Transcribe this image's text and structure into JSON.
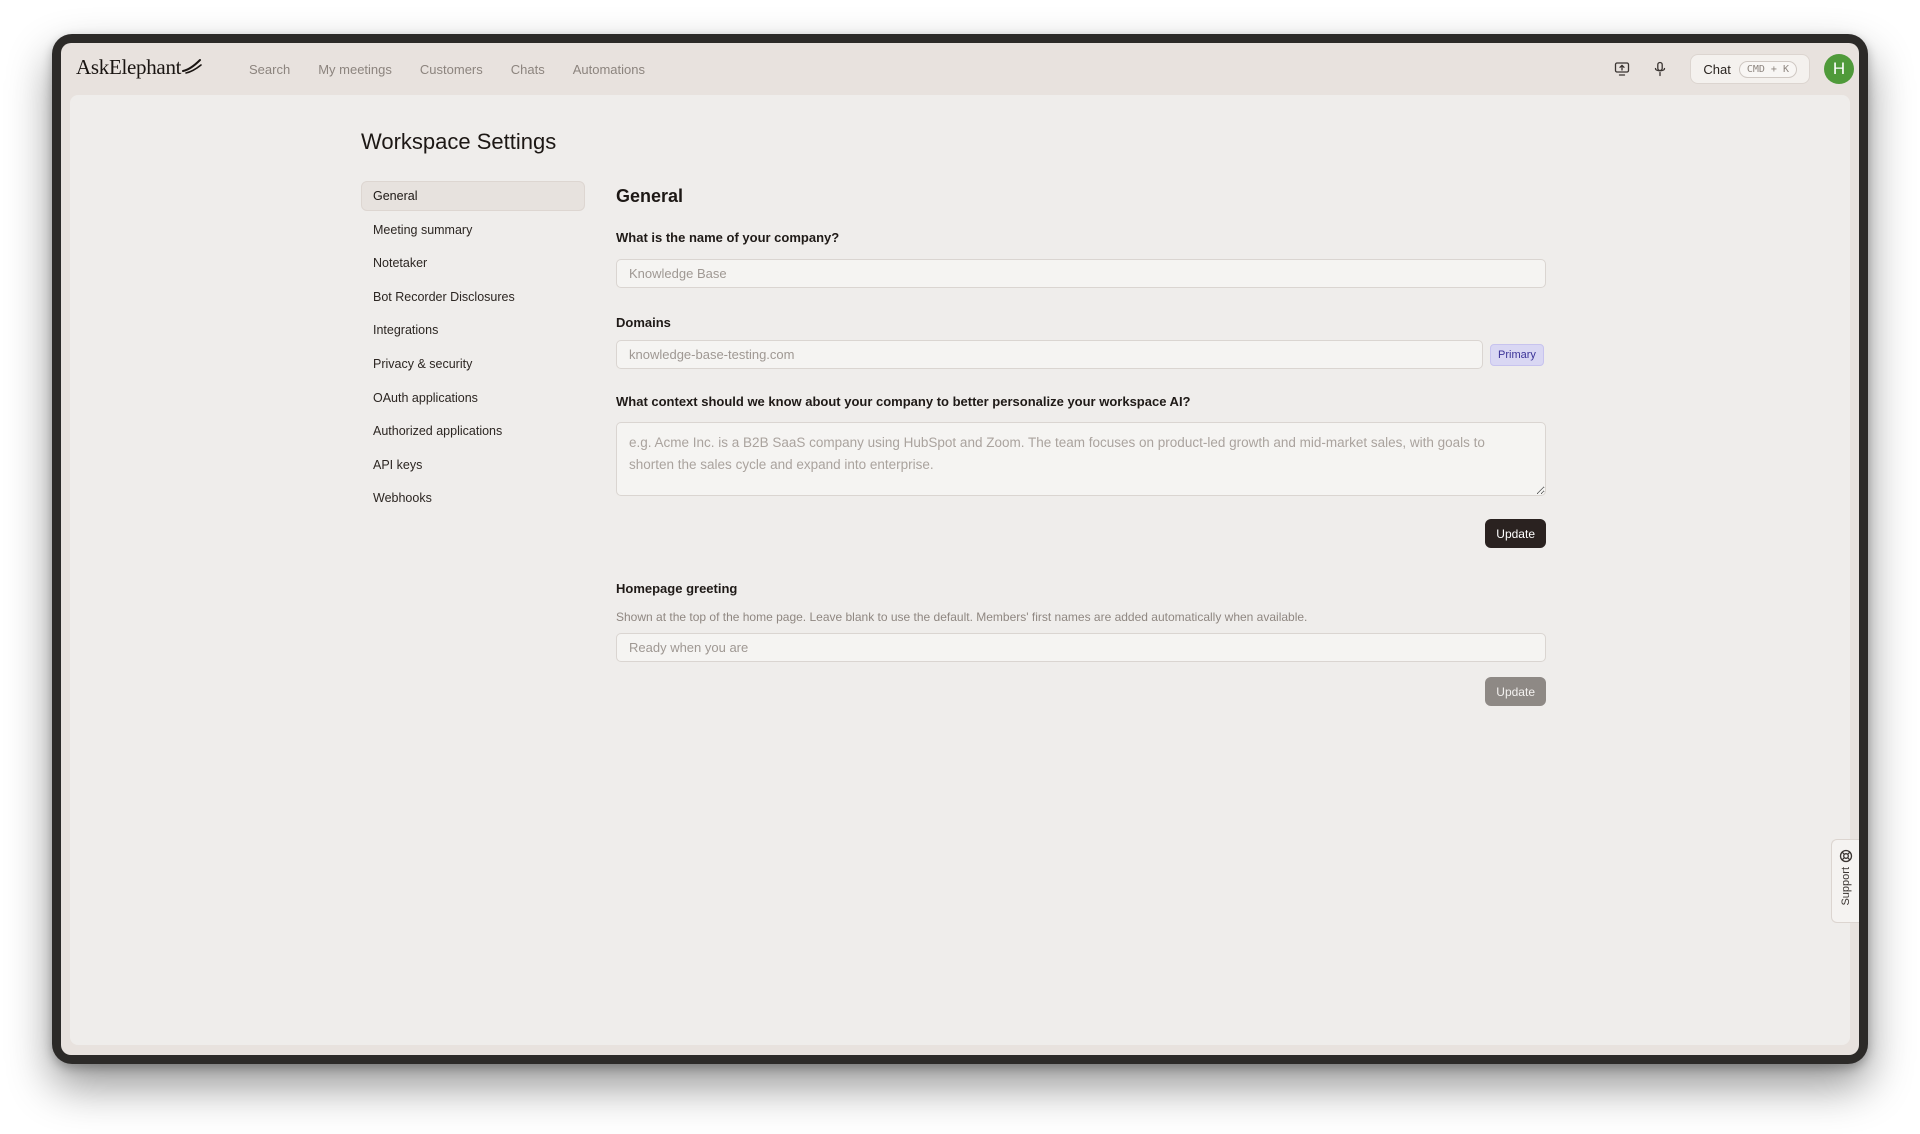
{
  "app": {
    "logo_text": "AskElephant",
    "nav": [
      "Search",
      "My meetings",
      "Customers",
      "Chats",
      "Automations"
    ],
    "chat_label": "Chat",
    "chat_shortcut": "CMD + K",
    "avatar_initial": "H",
    "icons": {
      "present": "screen-share-icon",
      "mic": "microphone-icon",
      "support": "lifebuoy-icon"
    }
  },
  "page": {
    "title": "Workspace Settings"
  },
  "sidebar": {
    "items": [
      {
        "label": "General",
        "active": true
      },
      {
        "label": "Meeting summary"
      },
      {
        "label": "Notetaker"
      },
      {
        "label": "Bot Recorder Disclosures"
      },
      {
        "label": "Integrations"
      },
      {
        "label": "Privacy & security"
      },
      {
        "label": "OAuth applications"
      },
      {
        "label": "Authorized applications"
      },
      {
        "label": "API keys"
      },
      {
        "label": "Webhooks"
      }
    ]
  },
  "general": {
    "heading": "General",
    "company_label": "What is the name of your company?",
    "company_placeholder": "Knowledge Base",
    "domains_label": "Domains",
    "domain_placeholder": "knowledge-base-testing.com",
    "primary_badge": "Primary",
    "context_label": "What context should we know about your company to better personalize your workspace AI?",
    "context_placeholder": "e.g. Acme Inc. is a B2B SaaS company using HubSpot and Zoom. The team focuses on product-led growth and mid-market sales, with goals to shorten the sales cycle and expand into enterprise.",
    "update_label": "Update"
  },
  "greeting": {
    "label": "Homepage greeting",
    "help": "Shown at the top of the home page. Leave blank to use the default. Members' first names are added automatically when available.",
    "placeholder": "Ready when you are",
    "update_label": "Update"
  },
  "support": {
    "label": "Support"
  },
  "colors": {
    "accent_dark": "#2a2220",
    "avatar": "#4f9a3a",
    "badge_bg": "#d9d7f3",
    "badge_text": "#3b3398"
  }
}
